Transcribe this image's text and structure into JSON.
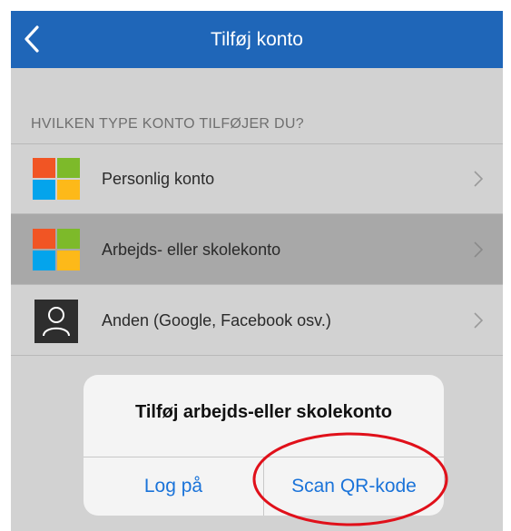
{
  "header": {
    "title": "Tilføj konto",
    "background_color": "#1f66b8"
  },
  "section": {
    "header": "HVILKEN TYPE KONTO TILFØJER DU?"
  },
  "accounts": [
    {
      "label": "Personlig konto",
      "icon": "microsoft-logo-icon",
      "selected": false
    },
    {
      "label": "Arbejds- eller skolekonto",
      "icon": "microsoft-logo-icon",
      "selected": true
    },
    {
      "label": "Anden (Google, Facebook osv.)",
      "icon": "person-icon",
      "selected": false
    }
  ],
  "dialog": {
    "title": "Tilføj arbejds-eller skolekonto",
    "buttons": [
      {
        "label": "Log på"
      },
      {
        "label": "Scan QR-kode",
        "highlighted": true
      }
    ]
  },
  "colors": {
    "accent": "#1a73d9",
    "highlight": "#e0101a",
    "selected_row": "#a8a8a8"
  }
}
